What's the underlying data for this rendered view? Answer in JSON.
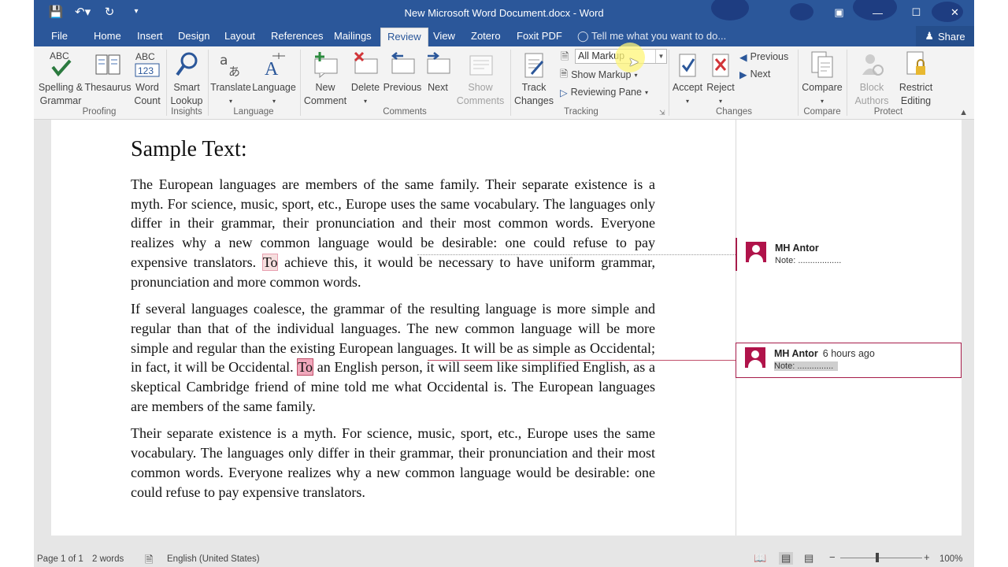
{
  "app": {
    "title": "New Microsoft Word Document.docx - Word"
  },
  "qat": [
    "save-icon",
    "undo-icon",
    "redo-icon",
    "customize-icon"
  ],
  "window_controls": [
    "ribbon-display-icon",
    "minimize-icon",
    "maximize-icon",
    "close-icon"
  ],
  "menu": {
    "tabs": [
      "File",
      "Home",
      "Insert",
      "Design",
      "Layout",
      "References",
      "Mailings",
      "Review",
      "View",
      "Zotero",
      "Foxit PDF"
    ],
    "active_tab": "Review",
    "tell_me": "Tell me what you want to do...",
    "share": "Share"
  },
  "ribbon": {
    "proofing": {
      "label": "Proofing",
      "spelling": "Spelling & Grammar",
      "thesaurus": "Thesaurus",
      "word_count": "Word Count"
    },
    "insights": {
      "label": "Insights",
      "smart_lookup": "Smart Lookup"
    },
    "language": {
      "label": "Language",
      "translate": "Translate",
      "language": "Language"
    },
    "comments": {
      "label": "Comments",
      "new": "New Comment",
      "delete": "Delete",
      "previous": "Previous",
      "next": "Next",
      "show": "Show Comments"
    },
    "tracking": {
      "label": "Tracking",
      "track_changes": "Track Changes",
      "markup_value": "All Markup",
      "show_markup": "Show Markup",
      "reviewing_pane": "Reviewing Pane"
    },
    "changes": {
      "label": "Changes",
      "accept": "Accept",
      "reject": "Reject",
      "previous": "Previous",
      "next": "Next"
    },
    "compare": {
      "label": "Compare",
      "compare": "Compare"
    },
    "protect": {
      "label": "Protect",
      "block_authors": "Block Authors",
      "restrict_editing": "Restrict Editing"
    }
  },
  "document": {
    "heading": "Sample Text:",
    "p1_before": "The European languages are members of the same family. Their separate existence is a myth. For science, music, sport, etc., Europe uses the same vocabulary. The languages only differ in their grammar, their pronunciation and their most common words. Everyone realizes why a new common language would be desirable: one could refuse to pay expensive translators. ",
    "p1_highlight": "To",
    "p1_after": " achieve this, it would be necessary to have uniform grammar, pronunciation and more common words.",
    "p2_before": "If several languages coalesce, the grammar of the resulting language is more simple and regular than that of the individual languages. The new common language will be more simple and regular than the existing European languages. It will be as simple as Occidental; in fact, it will be Occidental. ",
    "p2_highlight": "To",
    "p2_after": " an English person, it will seem like simplified English, as a skeptical Cambridge friend of mine told me what Occidental is. The European languages are members of the same family.",
    "p3": "Their separate existence is a myth. For science, music, sport, etc., Europe uses the same vocabulary. The languages only differ in their grammar, their pronunciation and their most common words. Everyone realizes why a new common language would be desirable: one could refuse to pay expensive translators."
  },
  "comments": [
    {
      "author": "MH Antor",
      "time": "",
      "note": "Note: .................."
    },
    {
      "author": "MH Antor",
      "time": "6 hours ago",
      "note": "Note: ..............."
    }
  ],
  "status": {
    "page": "Page 1 of 1",
    "words": "2 words",
    "language": "English (United States)",
    "zoom": "100%",
    "zoom_level_percent": 100
  },
  "colors": {
    "accent": "#2b579a",
    "comment": "#a61c4a"
  }
}
